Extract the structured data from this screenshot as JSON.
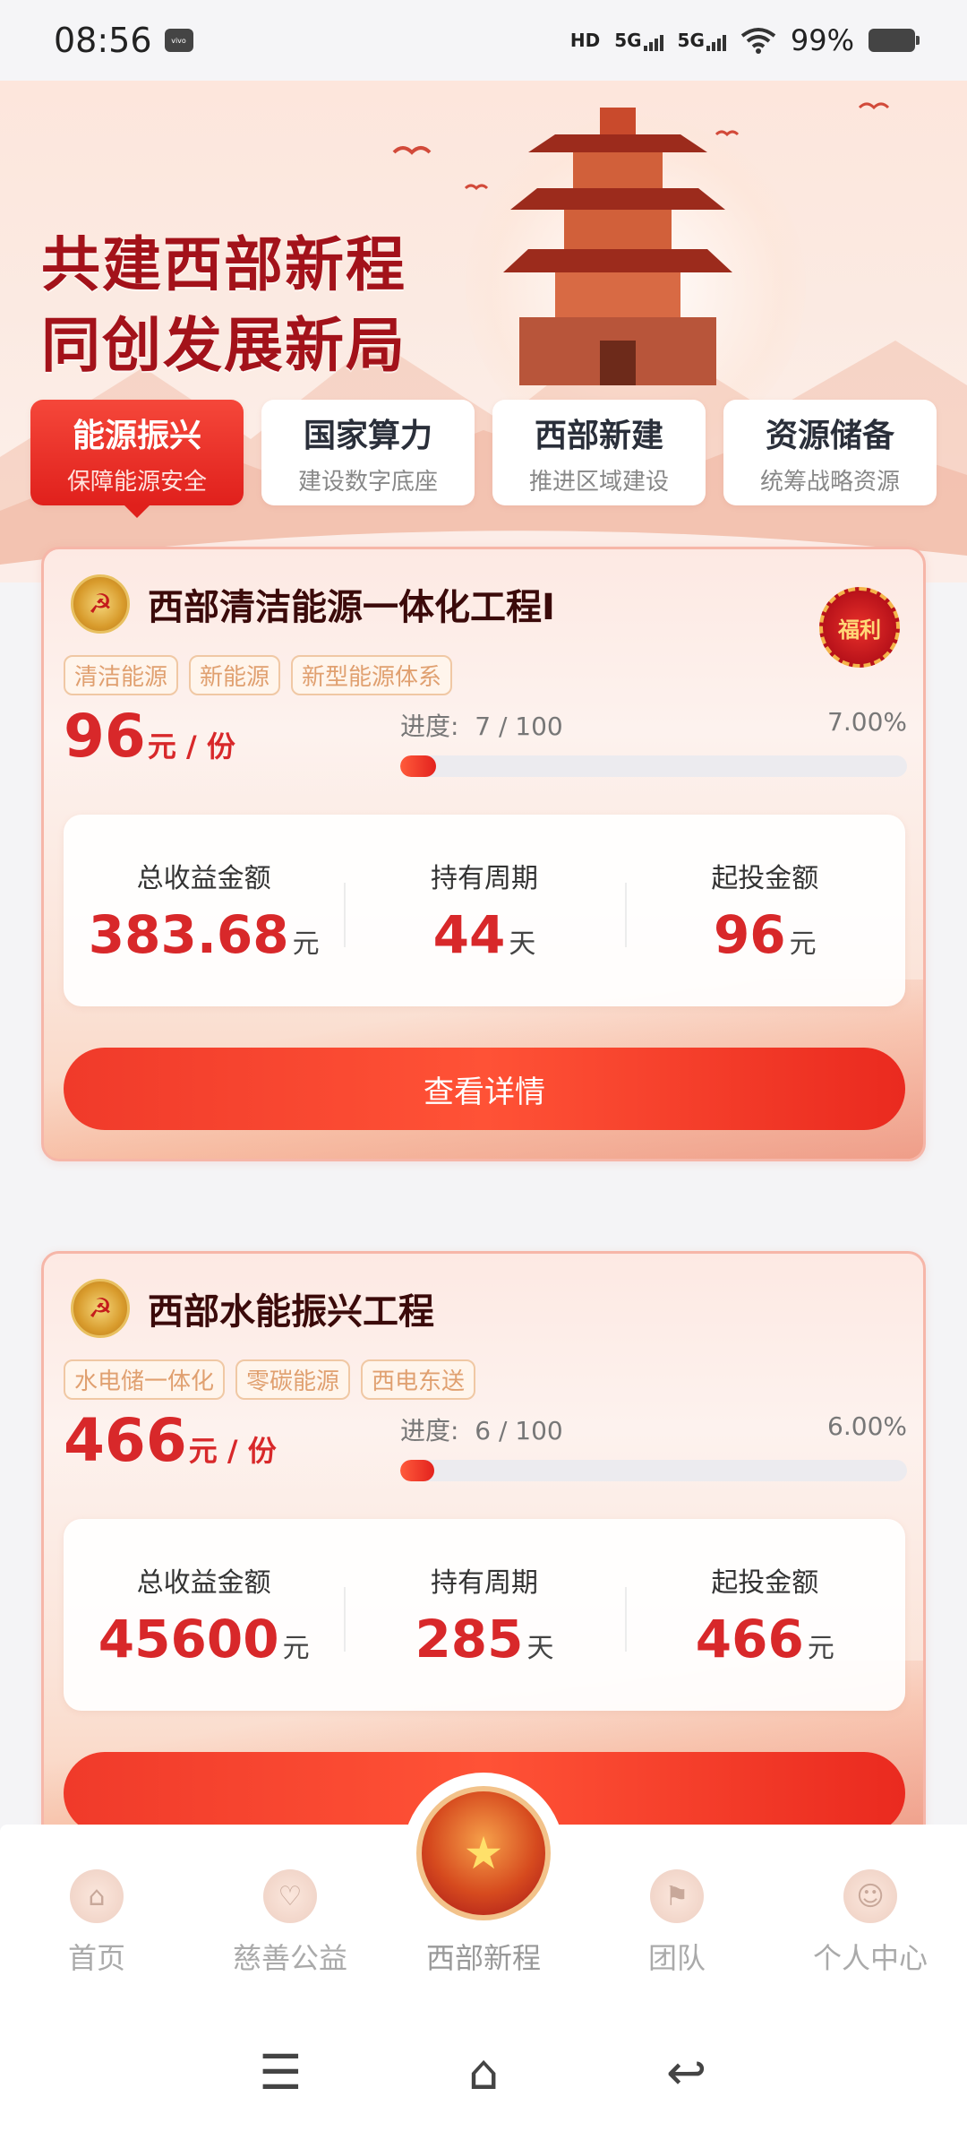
{
  "status_bar": {
    "time": "08:56",
    "brand_badge": "vivo",
    "network_label": "HD",
    "signal1": "5G",
    "signal2": "5G",
    "battery": "99%"
  },
  "hero": {
    "title_line1": "共建西部新程",
    "title_line2": "同创发展新局"
  },
  "tabs": [
    {
      "title": "能源振兴",
      "sub": "保障能源安全"
    },
    {
      "title": "国家算力",
      "sub": "建设数字底座"
    },
    {
      "title": "西部新建",
      "sub": "推进区域建设"
    },
    {
      "title": "资源储备",
      "sub": "统筹战略资源"
    }
  ],
  "cards": [
    {
      "title": "西部清洁能源一体化工程I",
      "badge": "福利",
      "chips": [
        "清洁能源",
        "新能源",
        "新型能源体系"
      ],
      "price": "96",
      "price_unit": "元 / 份",
      "progress_label": "进度:",
      "progress_value": "7 / 100",
      "progress_percent": "7.00%",
      "progress_fraction": 0.07,
      "stats": [
        {
          "label": "总收益金额",
          "value": "383.68",
          "unit": "元"
        },
        {
          "label": "持有周期",
          "value": "44",
          "unit": "天"
        },
        {
          "label": "起投金额",
          "value": "96",
          "unit": "元"
        }
      ],
      "button": "查看详情"
    },
    {
      "title": "西部水能振兴工程",
      "chips": [
        "水电储一体化",
        "零碳能源",
        "西电东送"
      ],
      "price": "466",
      "price_unit": "元 / 份",
      "progress_label": "进度:",
      "progress_value": "6 / 100",
      "progress_percent": "6.00%",
      "progress_fraction": 0.06,
      "stats": [
        {
          "label": "总收益金额",
          "value": "45600",
          "unit": "元"
        },
        {
          "label": "持有周期",
          "value": "285",
          "unit": "天"
        },
        {
          "label": "起投金额",
          "value": "466",
          "unit": "元"
        }
      ]
    }
  ],
  "bottom_nav": [
    {
      "label": "首页"
    },
    {
      "label": "慈善公益"
    },
    {
      "label": "西部新程"
    },
    {
      "label": "团队"
    },
    {
      "label": "个人中心"
    }
  ],
  "colors": {
    "accent": "#e0201c",
    "price": "#d8282a",
    "title_red": "#a3121a"
  }
}
